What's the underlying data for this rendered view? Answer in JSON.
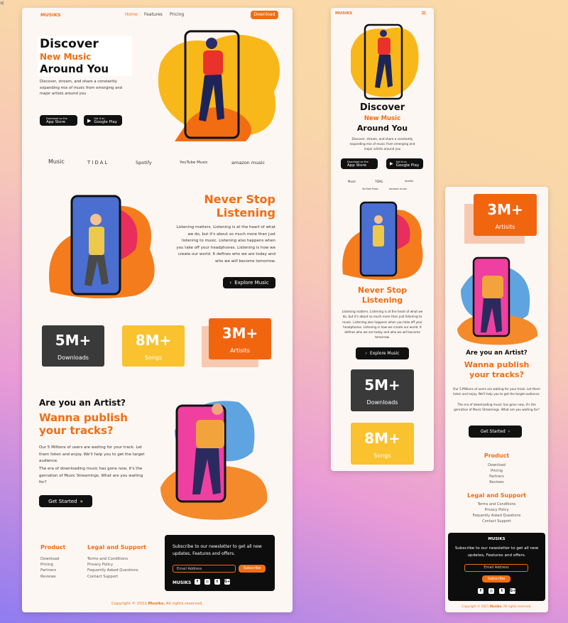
{
  "favicon_glyph": "뻬",
  "brand": "MUSIKS",
  "colors": {
    "accent": "#f26d12",
    "dark": "#3a3a3a",
    "yellow": "#f9c22e",
    "bg": "#fdf7f4"
  },
  "nav": {
    "home": "Home",
    "features": "Features",
    "pricing": "Pricing",
    "download": "Download"
  },
  "hero": {
    "line1": "Discover",
    "line2": "New Music",
    "line3": "Around You",
    "description": "Discover, stream, and share a constantly expanding mix of music from emerging and major artists around you",
    "appstore_small": "Download on the",
    "appstore_big": "App Store",
    "gplay_small": "Get it on",
    "gplay_big": "Google Play"
  },
  "partners": [
    "Music",
    "TIDAL",
    "Spotify",
    "YouTube Music",
    "amazon music"
  ],
  "listen": {
    "title1": "Never Stop",
    "title2": "Listening",
    "body": "Listening matters. Listening is at the heart of what we do, but it's about so much more than just listening to music. Listening also happens when you take off your headphones. Listening is how we create our world. It defines who we are today and who we will become tomorrow.",
    "cta": "Explore Music"
  },
  "stats": [
    {
      "num": "5M+",
      "label": "Downloads"
    },
    {
      "num": "8M+",
      "label": "Songs"
    },
    {
      "num": "3M+",
      "label": "Artisits"
    }
  ],
  "artist": {
    "q": "Are you an Artist?",
    "title1": "Wanna publish",
    "title2": "your tracks?",
    "body1": "Our 5 Millions of users are waiting for your track. Let them listen and enjoy. We'll help you to get the target audience.",
    "body2": "The era of downloading music has gone now, it's the genration of Music Streamings. What are you waiting for?",
    "cta": "Get Started"
  },
  "footer": {
    "product_title": "Product",
    "product": [
      "Download",
      "Pricing",
      "Partners",
      "Reviews"
    ],
    "legal_title": "Legal and Support",
    "legal": [
      "Terms and Conditions",
      "Privacy Policy",
      "Fequently Asked Questions",
      "Contact Support"
    ],
    "newsletter": "Subscribe to our newsletter to get all new updates, Features and offers.",
    "email_placeholder": "Email Address",
    "subscribe": "Subscribe",
    "social": [
      "f",
      "◎",
      "t",
      "G+"
    ],
    "copyright_pre": "Copyright ©  2021 ",
    "copyright_brand": "Musiks.",
    "copyright_post": " All rights reserved."
  }
}
